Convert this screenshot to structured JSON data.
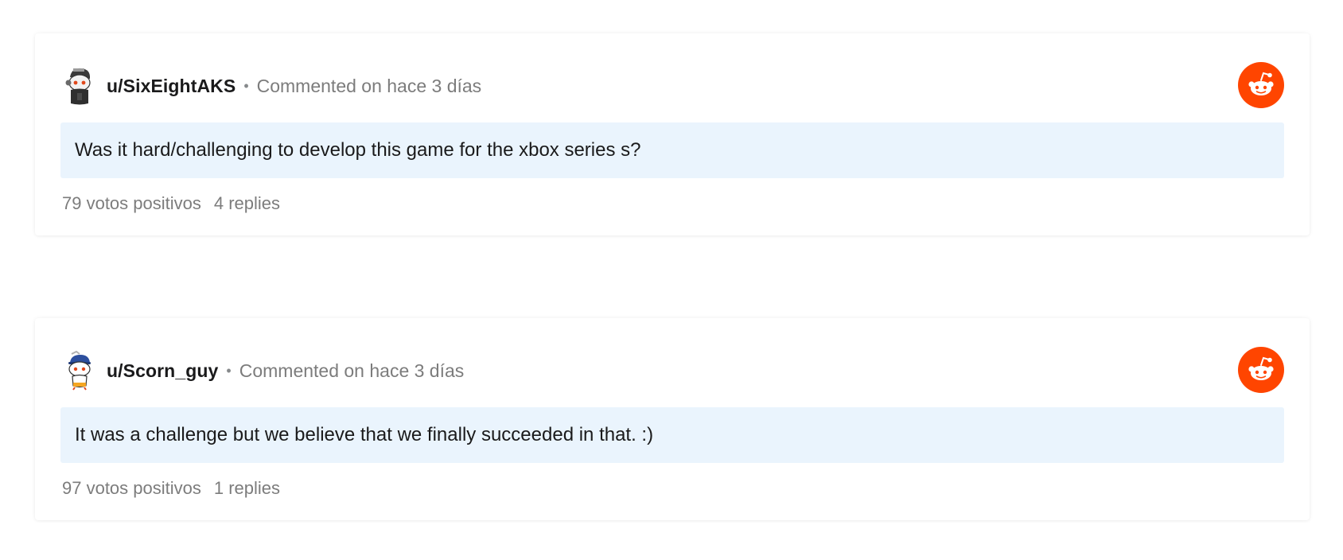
{
  "comments": [
    {
      "username": "u/SixEightAKS",
      "separator": "•",
      "meta": "Commented on hace 3 días",
      "body": "Was it hard/challenging to develop this game for the xbox series s?",
      "upvotes": "79 votos positivos",
      "replies": "4 replies",
      "avatar_icon": "snoo-avatar-icon"
    },
    {
      "username": "u/Scorn_guy",
      "separator": "•",
      "meta": "Commented on hace 3 días",
      "body": "It was a challenge but we believe that we finally succeeded in that. :)",
      "upvotes": "97 votos positivos",
      "replies": "1 replies",
      "avatar_icon": "snoo-avatar-icon"
    }
  ],
  "colors": {
    "reddit_orange": "#ff4500",
    "body_background": "#eaf4fd",
    "meta_gray": "#7c7c7c"
  },
  "logo_icon": "reddit-logo-icon"
}
